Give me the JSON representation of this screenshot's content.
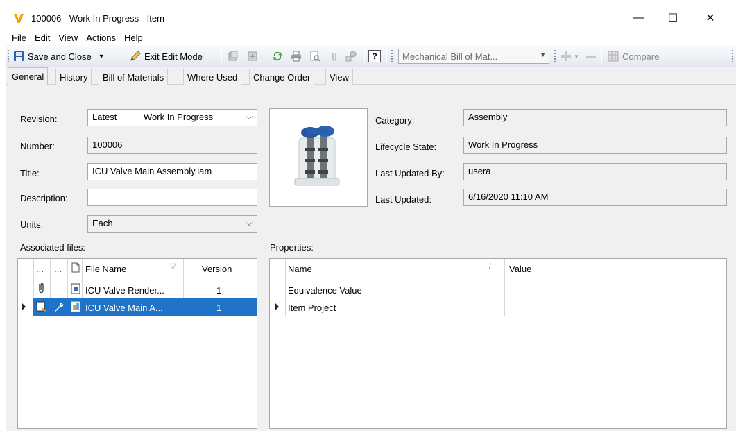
{
  "window": {
    "title": "100006 - Work In Progress - Item",
    "logo_letter": "V",
    "minimize": "—",
    "maximize": "☐",
    "close": "✕"
  },
  "menu": [
    "File",
    "Edit",
    "View",
    "Actions",
    "Help"
  ],
  "toolbar": {
    "save_close": "Save and Close",
    "exit_edit_mode": "Exit Edit Mode",
    "help_glyph": "?",
    "bom_view": "Mechanical Bill of Mat...",
    "compare": "Compare"
  },
  "tabs": [
    "General",
    "History",
    "Bill of Materials",
    "Where Used",
    "Change Order",
    "View"
  ],
  "general": {
    "revision_label": "Revision:",
    "revision_value": "Latest",
    "revision_state": "Work In Progress",
    "number_label": "Number:",
    "number_value": "100006",
    "title_label": "Title:",
    "title_value": "ICU Valve Main Assembly.iam",
    "description_label": "Description:",
    "description_value": "",
    "units_label": "Units:",
    "units_value": "Each",
    "category_label": "Category:",
    "category_value": "Assembly",
    "lifecycle_label": "Lifecycle State:",
    "lifecycle_value": "Work In Progress",
    "updated_by_label": "Last Updated By:",
    "updated_by_value": "usera",
    "updated_label": "Last Updated:",
    "updated_value": "6/16/2020 11:10 AM"
  },
  "files": {
    "section_label": "Associated files:",
    "col_dots1": "...",
    "col_dots2": "...",
    "col_name": "File Name",
    "col_version": "Version",
    "rows": [
      {
        "name": "ICU Valve Render...",
        "version": "1"
      },
      {
        "name": "ICU Valve Main A...",
        "version": "1"
      }
    ]
  },
  "properties": {
    "section_label": "Properties:",
    "col_name": "Name",
    "col_value": "Value",
    "rows": [
      {
        "name": "Equivalence Value",
        "value": ""
      },
      {
        "name": "Item Project",
        "value": ""
      }
    ]
  },
  "colors": {
    "selection": "#1f73c8",
    "logo": "#f0a300",
    "save_icon": "#2a5fb0"
  }
}
